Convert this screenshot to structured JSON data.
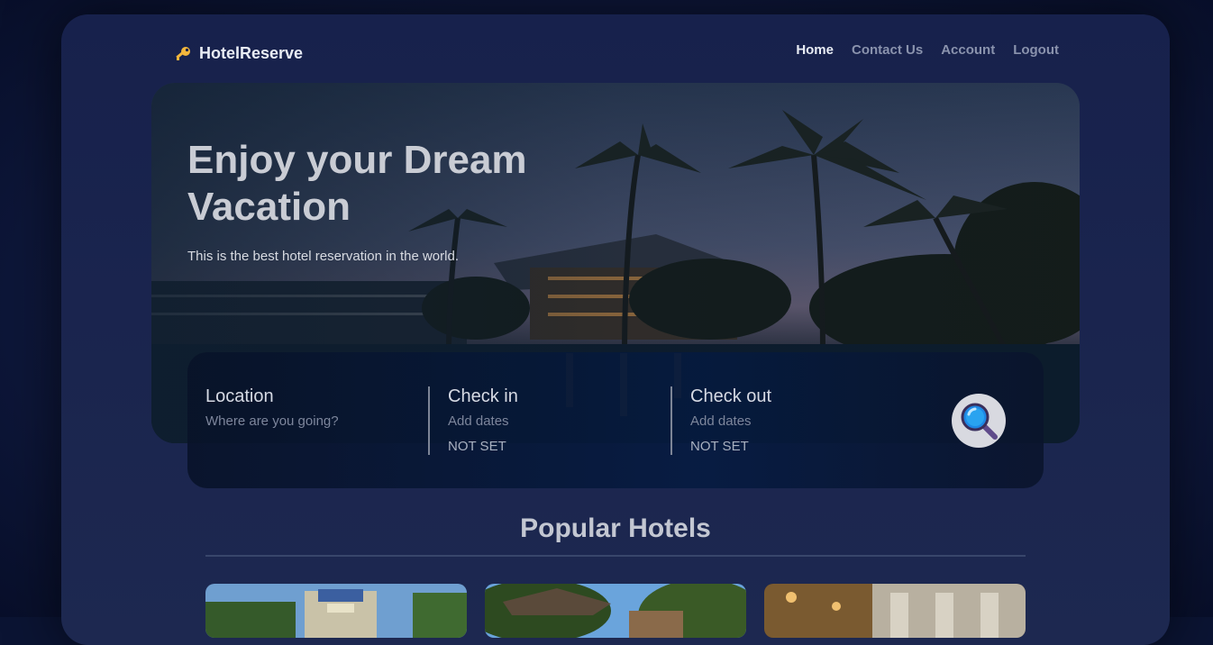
{
  "brand": {
    "name": "HotelReserve",
    "icon": "key-icon"
  },
  "nav": {
    "items": [
      {
        "label": "Home",
        "active": true
      },
      {
        "label": "Contact Us",
        "active": false
      },
      {
        "label": "Account",
        "active": false
      },
      {
        "label": "Logout",
        "active": false
      }
    ]
  },
  "hero": {
    "title": "Enjoy your Dream Vacation",
    "subtitle": "This is the best hotel reservation in the world."
  },
  "search": {
    "location": {
      "label": "Location",
      "placeholder": "Where are you going?"
    },
    "check_in": {
      "label": "Check in",
      "placeholder": "Add dates",
      "value": "NOT SET"
    },
    "check_out": {
      "label": "Check out",
      "placeholder": "Add dates",
      "value": "NOT SET"
    },
    "button_icon": "magnifier-icon"
  },
  "popular": {
    "title": "Popular Hotels",
    "cards": [
      {
        "image": "hotel-image-1"
      },
      {
        "image": "hotel-image-2"
      },
      {
        "image": "hotel-image-3"
      }
    ]
  },
  "colors": {
    "background": "#0b1433",
    "frame": "#1b254d",
    "accent_key": "#f2b63c",
    "search_icon_blue": "#1e88e5"
  }
}
